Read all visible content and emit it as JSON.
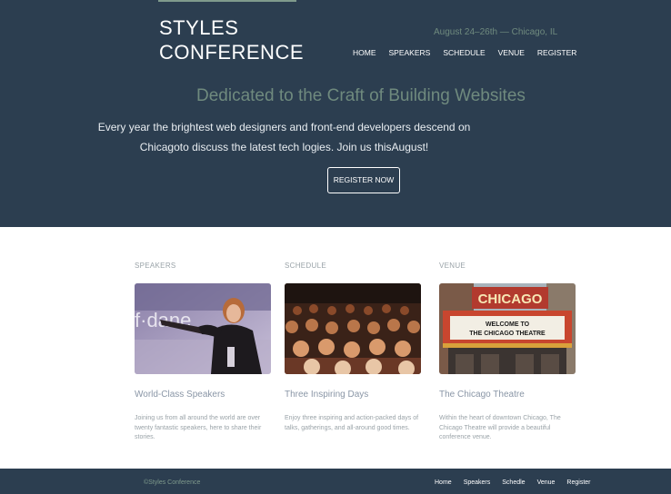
{
  "header": {
    "logo_line1": "STYLES",
    "logo_line2": "CONFERENCE",
    "tagline": "August 24–26th — Chicago, IL",
    "nav": [
      "HOME",
      "SPEAKERS",
      "SCHEDULE",
      "VENUE",
      "REGISTER"
    ]
  },
  "hero": {
    "title": "Dedicated to the Craft of Building Websites",
    "text": "Every year the brightest web designers and front-end developers descend on Chicagoto discuss the latest tech logies. Join us thisAugust!",
    "cta_label": "REGISTER NOW"
  },
  "features": [
    {
      "label": "SPEAKERS",
      "title": "World-Class Speakers",
      "desc": "Joining us from all around the world are over twenty fantastic speakers, here to share their stories."
    },
    {
      "label": "SCHEDULE",
      "title": "Three Inspiring Days",
      "desc": "Enjoy three inspiring and action-packed days of talks, gatherings, and all-around good times."
    },
    {
      "label": "VENUE",
      "title": "The Chicago Theatre",
      "desc": "Within the heart of downtown Chicago, The Chicago Theatre will provide a beautiful conference venue."
    }
  ],
  "venue_photo": {
    "sign": "CHICAGO",
    "marquee_line1": "WELCOME TO",
    "marquee_line2": "THE CHICAGO THEATRE"
  },
  "speaker_photo": {
    "backdrop_text": "f·dane"
  },
  "footer": {
    "copyright": "©Styles Conference",
    "nav": [
      "Home",
      "Speakers",
      "Schedle",
      "Venue",
      "Register"
    ]
  },
  "colors": {
    "primary_bg": "#2c3e50",
    "accent_green": "#6f8a7e",
    "muted_text": "#9aa3a8"
  }
}
